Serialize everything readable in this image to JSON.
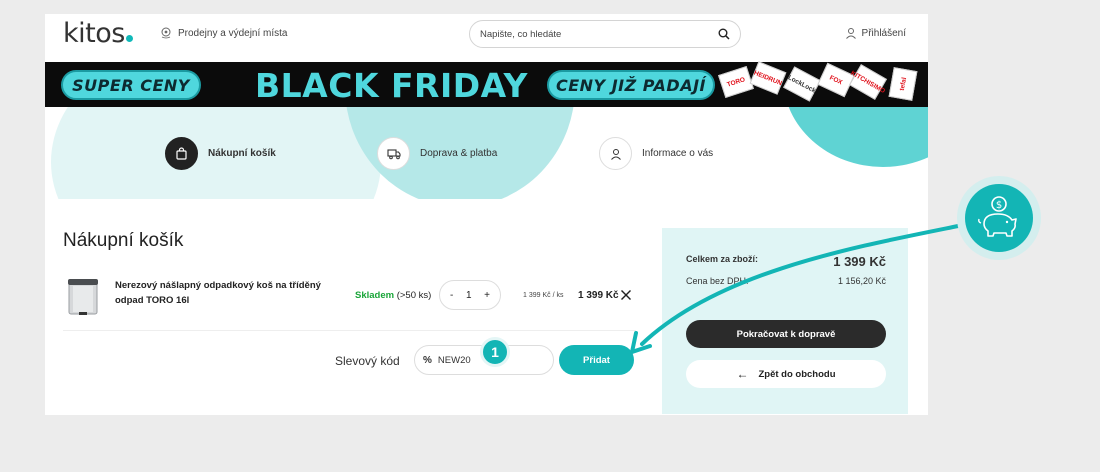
{
  "header": {
    "logo": "kitos",
    "stores_label": "Prodejny a výdejní místa",
    "search_placeholder": "Napište, co hledáte",
    "login_label": "Přihlášení"
  },
  "banner": {
    "left_pill": "SUPER CENY",
    "headline": "BLACK FRIDAY",
    "right_pill": "CENY JIŽ PADAJÍ",
    "brands": [
      "TORO",
      "HEIDRUN",
      "LockLock",
      "FOX",
      "KITCHISIMO",
      "tefal"
    ]
  },
  "steps": [
    {
      "label": "Nákupní košík",
      "icon": "bag-icon",
      "active": true
    },
    {
      "label": "Doprava & platba",
      "icon": "truck-icon",
      "active": false
    },
    {
      "label": "Informace o vás",
      "icon": "user-icon",
      "active": false
    }
  ],
  "cart": {
    "title": "Nákupní košík",
    "items": [
      {
        "name": "Nerezový nášlapný odpadkový koš na tříděný odpad TORO 16l",
        "stock_status": "Skladem",
        "stock_qty": "(>50 ks)",
        "quantity": "1",
        "minus": "-",
        "plus": "+",
        "unit_price": "1 399 Kč / ks",
        "price": "1 399 Kč"
      }
    ],
    "promo": {
      "label": "Slevový kód",
      "icon_text": "%",
      "value": "NEW20",
      "button": "Přidat",
      "step_number": "1"
    }
  },
  "summary": {
    "total_label": "Celkem za zboží:",
    "total_value": "1 399 Kč",
    "vat_label": "Cena bez DPH:",
    "vat_value": "1 156,20 Kč",
    "continue_button": "Pokračovat k dopravě",
    "back_button": "Zpět do obchodu"
  },
  "colors": {
    "accent": "#13b5b5",
    "summary_bg": "#e0f5f5",
    "banner_bg": "#0b0b0b",
    "banner_cyan": "#4fd7dd",
    "stock_green": "#1aa539"
  }
}
